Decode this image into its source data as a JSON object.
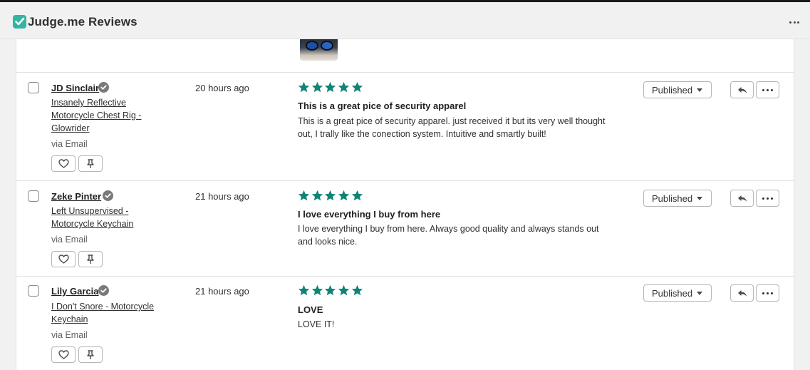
{
  "app": {
    "title": "Judge.me Reviews",
    "brand_color": "#33b5a3",
    "logo_icon": "judgeme-check-logo",
    "more_icon": "more-horizontal-icon"
  },
  "colors": {
    "star": "#108474",
    "border": "#b5b5b5"
  },
  "reviews": [
    {
      "name": "JD Sinclair",
      "product": "Insanely Reflective Motorcycle Chest Rig - Glowrider",
      "product_lines": [
        "Insanely Reflective",
        "Motorcycle Chest Rig -",
        "Glowrider"
      ],
      "source": "via Email",
      "time": "20 hours ago",
      "rating": 5,
      "title": "This is a great pice of security apparel",
      "body": "This is a great pice of security apparel. just received it but its very well thought out, I trally like the conection system. Intuitive and smartly built!",
      "status": "Published"
    },
    {
      "name": "Zeke Pinter",
      "product": "Left Unsupervised - Motorcycle Keychain",
      "product_lines": [
        "Left Unsupervised -",
        "Motorcycle Keychain"
      ],
      "source": "via Email",
      "time": "21 hours ago",
      "rating": 5,
      "title": "I love everything I buy from here",
      "body": "I love everything I buy from here. Always good quality and always stands out and looks nice.",
      "status": "Published"
    },
    {
      "name": "Lily Garcia",
      "product": "I Don't Snore - Motorcycle Keychain",
      "product_lines": [
        "I Don't Snore - Motorcycle",
        "Keychain"
      ],
      "source": "via Email",
      "time": "21 hours ago",
      "rating": 5,
      "title": "LOVE",
      "body": "LOVE IT!",
      "status": "Published"
    }
  ]
}
